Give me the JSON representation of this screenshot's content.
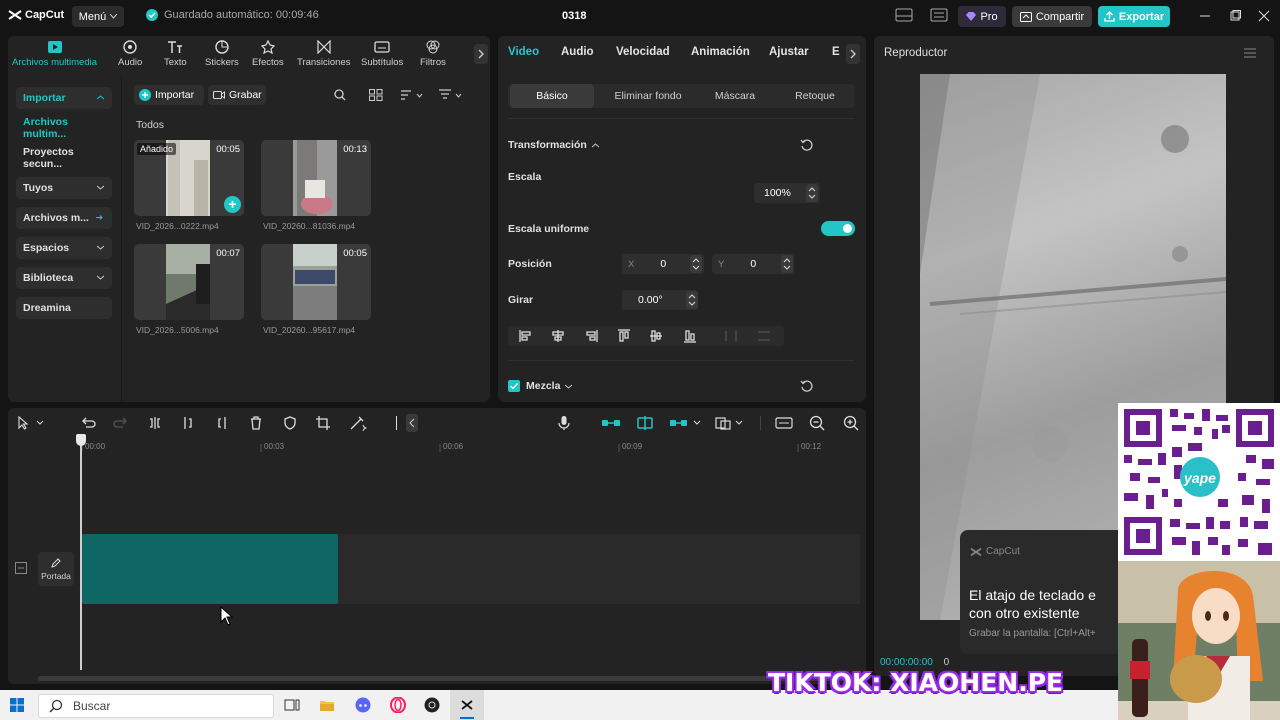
{
  "titlebar": {
    "logo": "CapCut",
    "menu": "Menú",
    "autosave": "Guardado automático: 00:09:46",
    "project_title": "0318",
    "pro": "Pro",
    "share": "Compartir",
    "export": "Exportar"
  },
  "media_tabs": [
    {
      "label": "Archivos multimedia",
      "icon": "media-icon"
    },
    {
      "label": "Audio",
      "icon": "audio-icon"
    },
    {
      "label": "Texto",
      "icon": "text-icon"
    },
    {
      "label": "Stickers",
      "icon": "stickers-icon"
    },
    {
      "label": "Efectos",
      "icon": "effects-icon"
    },
    {
      "label": "Transiciones",
      "icon": "transitions-icon"
    },
    {
      "label": "Subtítulos",
      "icon": "subtitles-icon"
    },
    {
      "label": "Filtros",
      "icon": "filters-icon"
    }
  ],
  "sidebar": [
    {
      "label": "Importar"
    },
    {
      "label": "Archivos multim..."
    },
    {
      "label": "Proyectos secun..."
    },
    {
      "label": "Tuyos"
    },
    {
      "label": "Archivos m..."
    },
    {
      "label": "Espacios"
    },
    {
      "label": "Biblioteca"
    },
    {
      "label": "Dreamina"
    }
  ],
  "media": {
    "import_btn": "Importar",
    "record_btn": "Grabar",
    "section": "Todos",
    "items": [
      {
        "duration": "00:05",
        "name": "VID_2026...0222.mp4",
        "badge": "Añadido"
      },
      {
        "duration": "00:13",
        "name": "VID_20260...81036.mp4"
      },
      {
        "duration": "00:07",
        "name": "VID_2026...5006.mp4"
      },
      {
        "duration": "00:05",
        "name": "VID_20260...95617.mp4"
      }
    ]
  },
  "props": {
    "tabs": [
      "Video",
      "Audio",
      "Velocidad",
      "Animación",
      "Ajustar",
      "E"
    ],
    "subtabs": [
      "Básico",
      "Eliminar fondo",
      "Máscara",
      "Retoque"
    ],
    "transform": "Transformación",
    "scale_label": "Escala",
    "scale_value": "100%",
    "uniform_scale": "Escala uniforme",
    "position_label": "Posición",
    "pos_x_label": "X",
    "pos_x": "0",
    "pos_y_label": "Y",
    "pos_y": "0",
    "rotate_label": "Girar",
    "rotate_value": "0.00°",
    "blend": "Mezcla"
  },
  "player": {
    "title": "Reproductor",
    "timecode": "00:00:00:00",
    "timecode_suffix": "0"
  },
  "toast": {
    "app": "CapCut",
    "line1": "El atajo de teclado e",
    "line2": "con otro existente",
    "hint": "Grabar la pantalla: [Ctrl+Alt+"
  },
  "timeline": {
    "ruler": [
      "00:00",
      "00:03",
      "00:06",
      "00:09",
      "00:12"
    ],
    "cover": "Portada"
  },
  "taskbar": {
    "search": "Buscar"
  },
  "overlay": {
    "tiktok": "TIKTOK: XIAOHEN.PE",
    "yape_logo": "yape"
  },
  "colors": {
    "accent": "#22c6c6",
    "clip": "#0e6763",
    "panel": "#232323",
    "background": "#141414"
  }
}
